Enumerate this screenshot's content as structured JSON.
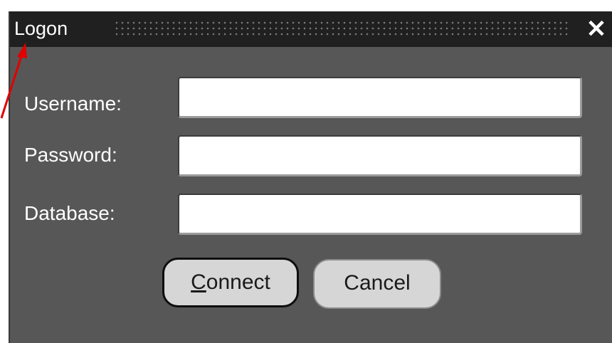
{
  "window": {
    "title": "Logon",
    "close_glyph": "✕"
  },
  "form": {
    "username_label": "Username:",
    "username_value": "",
    "password_label": "Password:",
    "password_value": "",
    "database_label": "Database:",
    "database_value": ""
  },
  "buttons": {
    "connect_mnemonic": "C",
    "connect_rest": "onnect",
    "cancel_label": "Cancel"
  },
  "annotation": {
    "arrow_color": "#e00000"
  },
  "colors": {
    "titlebar": "#202020",
    "dialog_body": "#575757",
    "button_face": "#d6d6d6"
  }
}
